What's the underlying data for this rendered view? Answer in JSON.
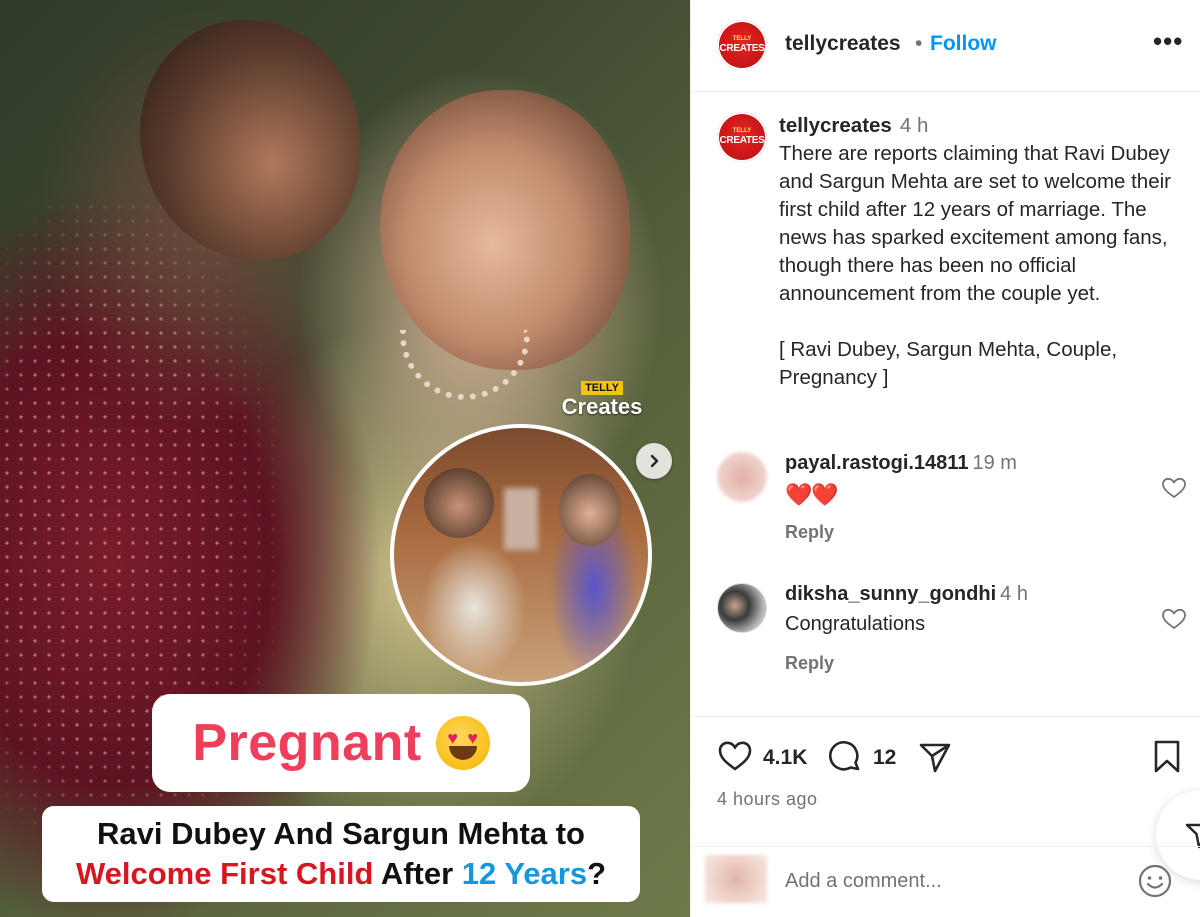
{
  "media": {
    "watermark_top": "TELLY",
    "watermark_main": "Creates",
    "pill_word": "Pregnant",
    "headline": {
      "line1": "Ravi Dubey And Sargun Mehta to",
      "line2_red": "Welcome First Child",
      "line2_mid": " After ",
      "line2_blue": "12 Years",
      "line2_end": "?"
    }
  },
  "header": {
    "logo_top": "TELLY",
    "logo_main": "CREATES",
    "username": "tellycreates",
    "separator": "•",
    "follow_label": "Follow",
    "more_label": "•••"
  },
  "caption": {
    "username": "tellycreates",
    "time": "4 h",
    "text": "There are reports claiming that Ravi Dubey and Sargun Mehta are set to welcome their first child after 12 years of marriage. The news has sparked excitement among fans, though there has been no official announcement from the couple yet.",
    "tags": "[ Ravi Dubey, Sargun Mehta, Couple, Pregnancy ]"
  },
  "comments": [
    {
      "username": "payal.rastogi.14811",
      "time": "19 m",
      "text": "❤️❤️",
      "reply": "Reply"
    },
    {
      "username": "diksha_sunny_gondhi",
      "time": "4 h",
      "text": "Congratulations",
      "reply": "Reply"
    }
  ],
  "actions": {
    "likes": "4.1K",
    "comments": "12",
    "posted": "4 hours ago"
  },
  "composer": {
    "placeholder": "Add a comment..."
  },
  "colors": {
    "accent_blue": "#0095f6",
    "pill_pink": "#ef3e5c",
    "headline_red": "#d8161f",
    "headline_blue": "#1597e0",
    "brand_red": "#e82424"
  }
}
